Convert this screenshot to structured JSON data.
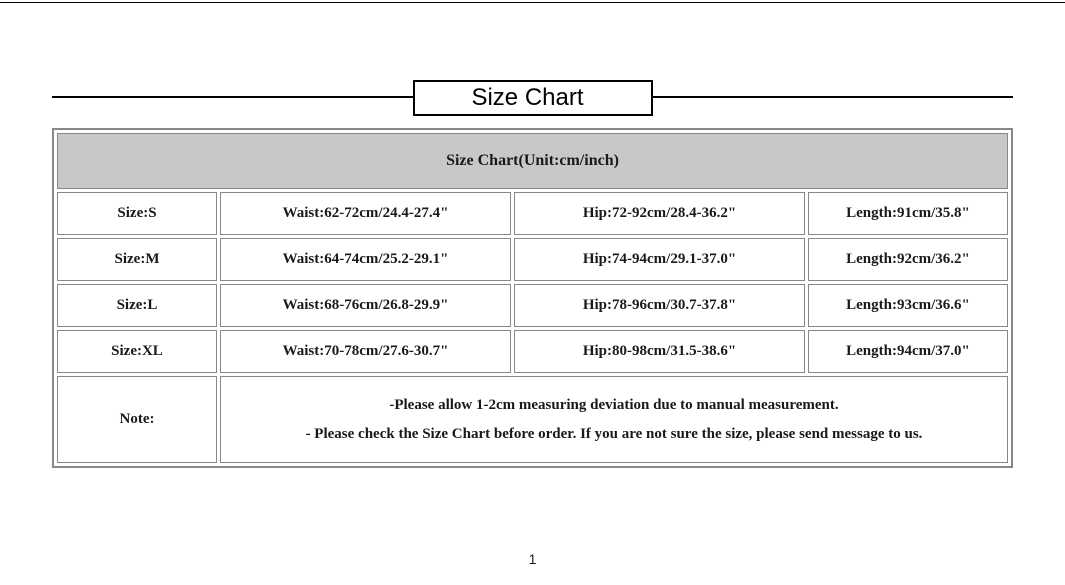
{
  "title": "Size Chart",
  "header": "Size Chart(Unit:cm/inch)",
  "rows": [
    {
      "size": "Size:S",
      "waist": "Waist:62-72cm/24.4-27.4\"",
      "hip": "Hip:72-92cm/28.4-36.2\"",
      "length": "Length:91cm/35.8\""
    },
    {
      "size": "Size:M",
      "waist": "Waist:64-74cm/25.2-29.1\"",
      "hip": "Hip:74-94cm/29.1-37.0\"",
      "length": "Length:92cm/36.2\""
    },
    {
      "size": "Size:L",
      "waist": "Waist:68-76cm/26.8-29.9\"",
      "hip": "Hip:78-96cm/30.7-37.8\"",
      "length": "Length:93cm/36.6\""
    },
    {
      "size": "Size:XL",
      "waist": "Waist:70-78cm/27.6-30.7\"",
      "hip": "Hip:80-98cm/31.5-38.6\"",
      "length": "Length:94cm/37.0\""
    }
  ],
  "note_label": "Note:",
  "note_line1": "-Please allow 1-2cm measuring deviation due to manual measurement.",
  "note_line2": "- Please check the Size Chart before order. If you are not sure the size, please send message to us.",
  "page": "1"
}
